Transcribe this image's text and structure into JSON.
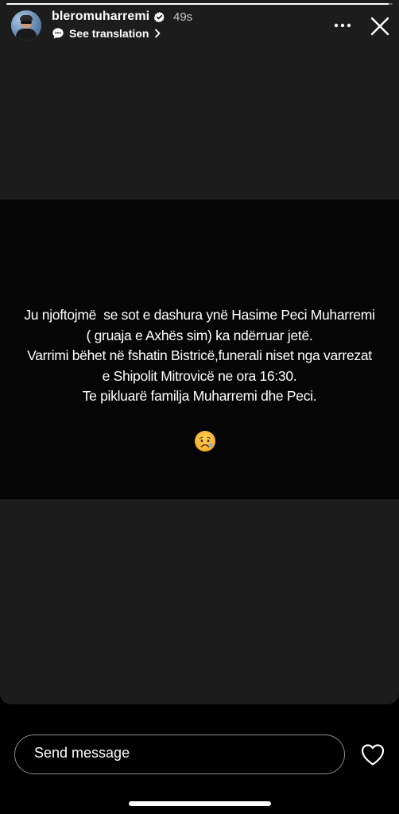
{
  "story": {
    "progress": 0.99,
    "text_lines": [
      "Ju njoftojmë  se sot e dashura ynë Hasime Peci Muharremi",
      "( gruaja e Axhës sim) ka ndërruar jetë.",
      "Varrimi bëhet në fshatin Bistricë,funerali niset nga varrezat",
      "e Shipolit Mitrovicë ne ora 16:30.",
      "Te pikluarë familja Muharremi dhe Peci."
    ],
    "emoji": "😥"
  },
  "header": {
    "username": "bleromuharremi",
    "timestamp": "49s",
    "translate_label": "See translation",
    "icons": [
      "verified-badge-icon",
      "translate-icon",
      "chevron-right-icon",
      "more-icon",
      "close-icon"
    ]
  },
  "footer": {
    "message_placeholder": "Send message",
    "icons": [
      "heart-icon"
    ]
  },
  "colors": {
    "background": "#000000",
    "card": "#1c1c1c",
    "media": "#050505",
    "verified": "#3897f0",
    "text": "#ffffff"
  }
}
